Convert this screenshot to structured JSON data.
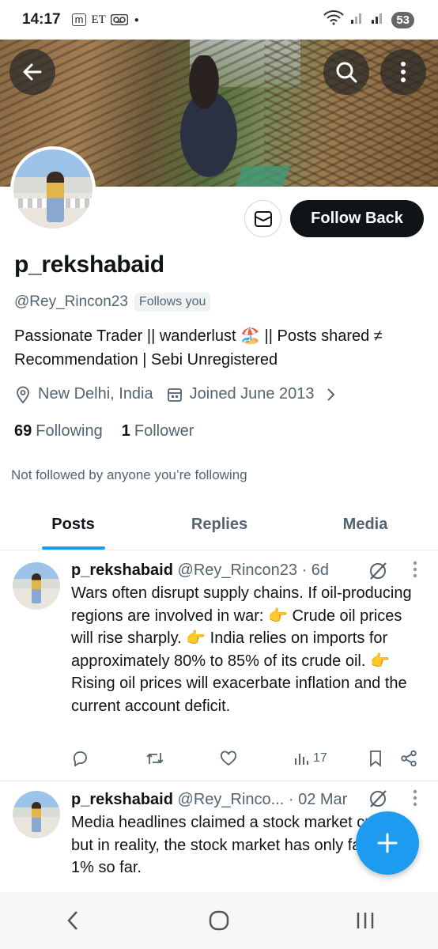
{
  "status_bar": {
    "time": "14:17",
    "icon_m": "m",
    "icon_et": "ET",
    "icon_voicemail": "voicemail-icon",
    "battery": "53"
  },
  "header": {
    "back_icon": "back-arrow-icon",
    "search_icon": "search-icon",
    "more_icon": "more-vertical-icon"
  },
  "profile": {
    "name": "p_rekshabaid",
    "handle": "@Rey_Rincon23",
    "follows_you": "Follows you",
    "bio_line1": "Passionate Trader || wanderlust 🏖️ || Posts shared ≠",
    "bio_line2": "Recommendation | Sebi Unregistered",
    "location": "New Delhi, India",
    "joined": "Joined June 2013",
    "following_count": "69",
    "following_label": "Following",
    "follower_count": "1",
    "follower_label": "Follower",
    "not_followed": "Not followed by anyone you’re following"
  },
  "actions": {
    "follow_back": "Follow Back"
  },
  "tabs": [
    {
      "label": "Posts",
      "active": true
    },
    {
      "label": "Replies",
      "active": false
    },
    {
      "label": "Media",
      "active": false
    }
  ],
  "posts": [
    {
      "name": "p_rekshabaid",
      "handle_time": "@Rey_Rincon23 · 6d",
      "text": "Wars often disrupt supply chains. If oil-producing regions are involved in war: 👉 Crude oil prices will rise sharply. 👉 India relies on imports for approximately 80% to 85% of its crude oil. 👉 Rising oil prices will exacerbate inflation and the current account deficit.",
      "views": "17"
    },
    {
      "name": "p_rekshabaid",
      "handle_time": "@Rey_Rinco... · 02 Mar",
      "text": "Media headlines claimed a stock market crash, but in reality, the stock market has only fallen by 1% so far."
    }
  ],
  "colors": {
    "accent": "#1d9bf0",
    "text": "#0f1419",
    "muted": "#536471"
  }
}
